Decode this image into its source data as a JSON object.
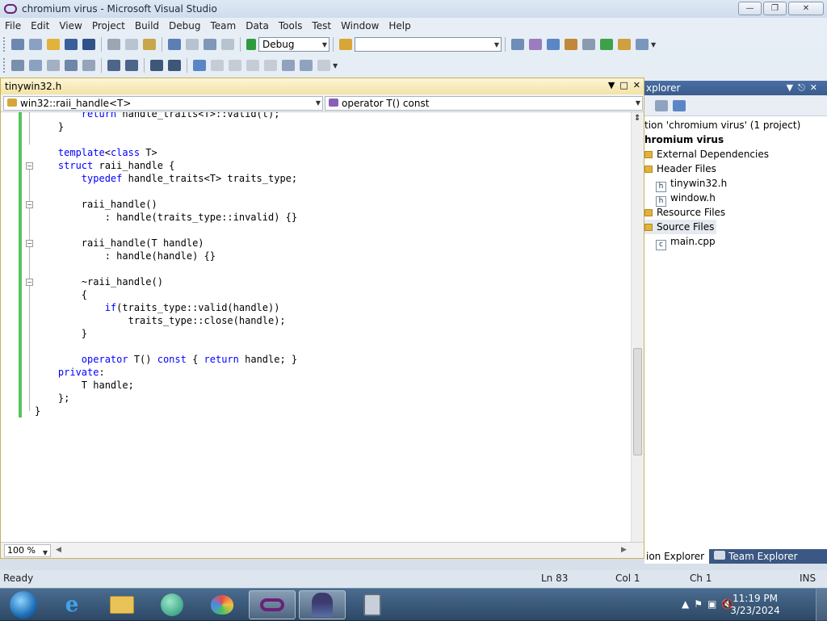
{
  "window": {
    "title": "chromium virus - Microsoft Visual Studio",
    "controls": [
      "minimize",
      "maximize",
      "close"
    ]
  },
  "menu": [
    "File",
    "Edit",
    "View",
    "Project",
    "Build",
    "Debug",
    "Team",
    "Data",
    "Tools",
    "Test",
    "Window",
    "Help"
  ],
  "toolbar": {
    "config": "Debug",
    "platform": ""
  },
  "editor": {
    "tab_title": "tinywin32.h",
    "nav_left": "win32::raii_handle<T>",
    "nav_right": "operator T() const",
    "zoom": "100 %",
    "code_lines": [
      "        return handle_traits<T>::valid(t);",
      "    }",
      "",
      "    template<class T>",
      "    struct raii_handle {",
      "        typedef handle_traits<T> traits_type;",
      "",
      "        raii_handle()",
      "            : handle(traits_type::invalid) {}",
      "",
      "        raii_handle(T handle)",
      "            : handle(handle) {}",
      "",
      "        ~raii_handle()",
      "        {",
      "            if(traits_type::valid(handle))",
      "                traits_type::close(handle);",
      "        }",
      "",
      "        operator T() const { return handle; }",
      "    private:",
      "        T handle;",
      "    };",
      "}"
    ]
  },
  "solution_explorer": {
    "title": "xplorer",
    "solution": "tion 'chromium virus' (1 project)",
    "project": "hromium virus",
    "items": [
      {
        "label": "External Dependencies",
        "type": "folder"
      },
      {
        "label": "Header Files",
        "type": "folder"
      },
      {
        "label": "tinywin32.h",
        "type": "header"
      },
      {
        "label": "window.h",
        "type": "header"
      },
      {
        "label": "Resource Files",
        "type": "folder"
      },
      {
        "label": "Source Files",
        "type": "folder"
      },
      {
        "label": "main.cpp",
        "type": "source"
      }
    ],
    "tabs": [
      "ion Explorer",
      "Team Explorer"
    ]
  },
  "status": {
    "text": "Ready",
    "line": "Ln 83",
    "col": "Col 1",
    "ch": "Ch 1",
    "mode": "INS"
  },
  "taskbar": {
    "apps": [
      "start-orb",
      "internet-explorer",
      "file-explorer",
      "media-app",
      "paint",
      "visual-studio",
      "spy-app",
      "calculator"
    ],
    "time": "11:19 PM",
    "date": "3/23/2024"
  },
  "colors": {
    "keyword": "#0000ff",
    "change_bar": "#5ac35a",
    "tool_window_title": "#3b5c8c",
    "editor_tab": "#f2e3a6"
  }
}
